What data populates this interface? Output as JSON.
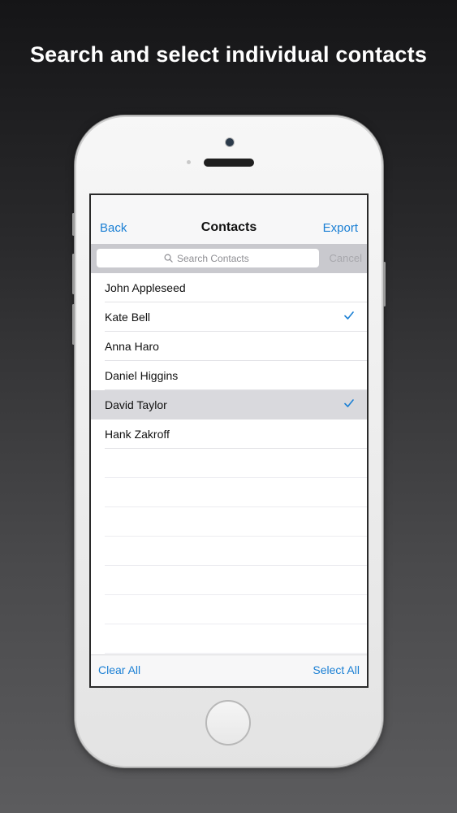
{
  "headline": "Search and select individual contacts",
  "nav": {
    "back_label": "Back",
    "title": "Contacts",
    "export_label": "Export"
  },
  "search": {
    "placeholder": "Search Contacts",
    "cancel_label": "Cancel",
    "icon": "search-icon"
  },
  "contacts": [
    {
      "name": "John Appleseed",
      "checked": false
    },
    {
      "name": "Kate Bell",
      "checked": true
    },
    {
      "name": "Anna Haro",
      "checked": false
    },
    {
      "name": "Daniel Higgins",
      "checked": false
    },
    {
      "name": "David Taylor",
      "checked": true,
      "highlighted": true
    },
    {
      "name": "Hank Zakroff",
      "checked": false
    }
  ],
  "toolbar": {
    "clear_all_label": "Clear All",
    "select_all_label": "Select All"
  },
  "colors": {
    "accent": "#1a7fd4",
    "highlight_row": "#d9d9dd",
    "search_bar_bg": "#c9c9ce"
  }
}
